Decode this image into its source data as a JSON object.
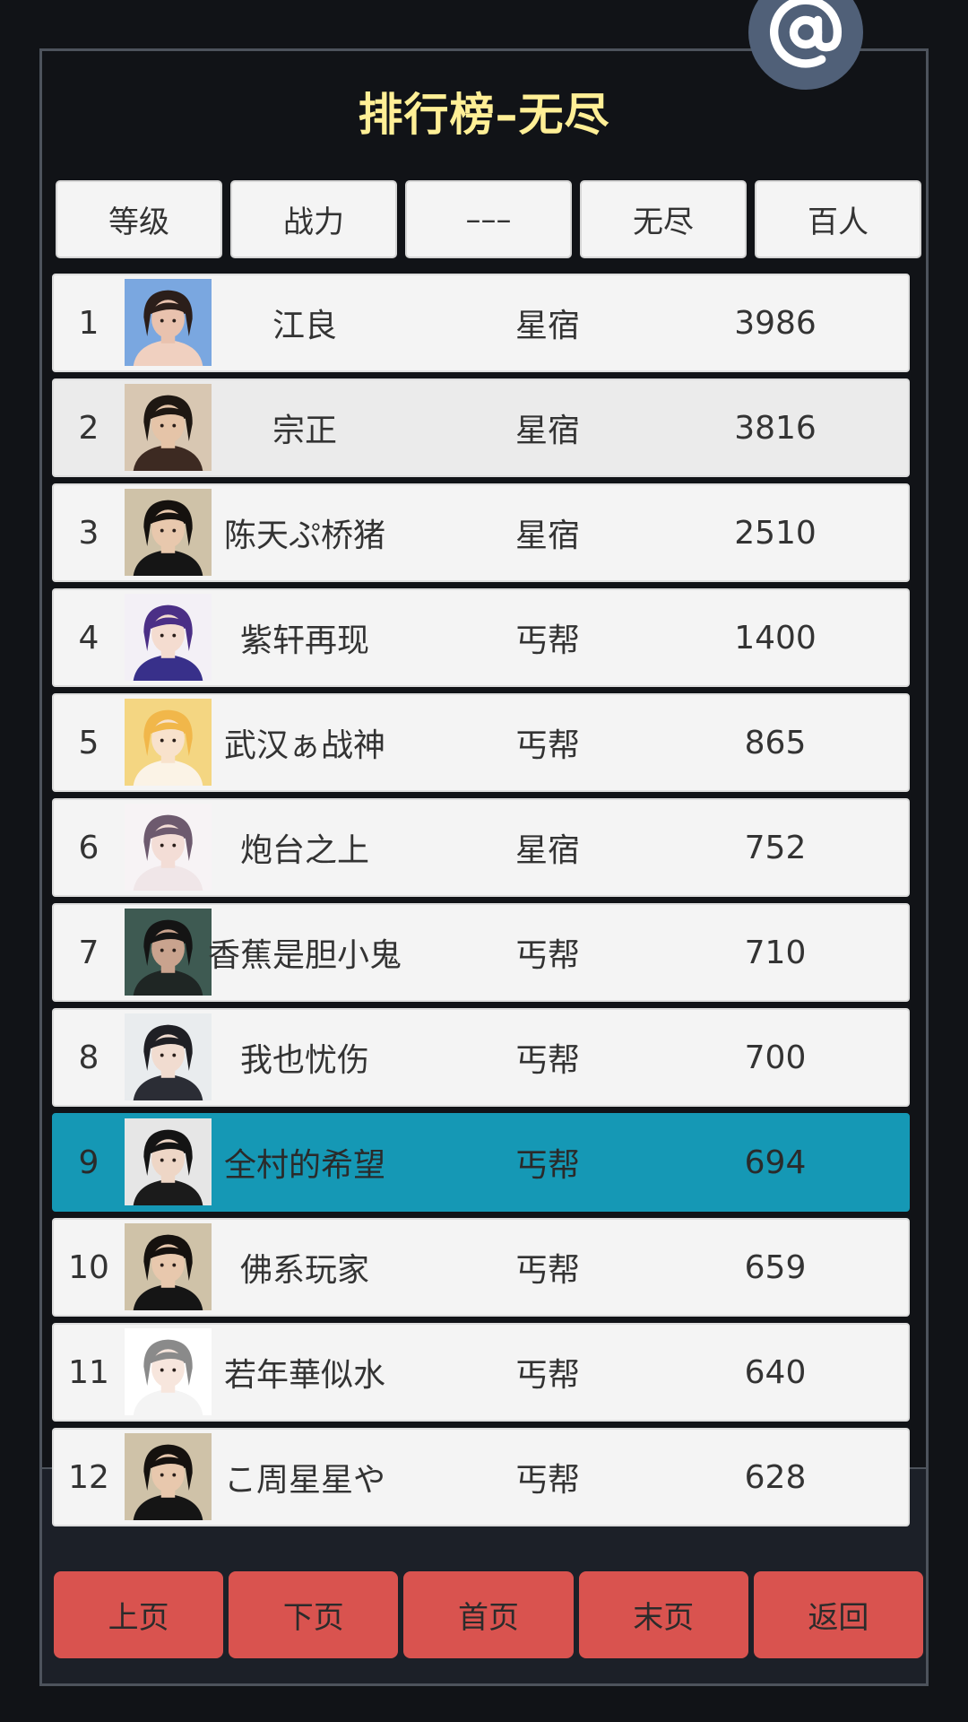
{
  "colors": {
    "background": "#111317",
    "title": "#ffef96",
    "highlight_row": "#1598b5",
    "nav_button": "#d9534f",
    "tab": "#f4f4f4",
    "badge": "#506078"
  },
  "header": {
    "title": "排行榜–无尽",
    "badge_icon": "at-icon"
  },
  "tabs": [
    {
      "label": "等级"
    },
    {
      "label": "战力"
    },
    {
      "label": "–––"
    },
    {
      "label": "无尽"
    },
    {
      "label": "百人"
    }
  ],
  "rows": [
    {
      "rank": "1",
      "name": "江良",
      "guild": "星宿",
      "score": "3986",
      "avatar": "avatar-long-hair-girl"
    },
    {
      "rank": "2",
      "name": "宗正",
      "guild": "星宿",
      "score": "3816",
      "avatar": "avatar-ancient-warrior"
    },
    {
      "rank": "3",
      "name": "陈天ぷ桥猪",
      "guild": "星宿",
      "score": "2510",
      "avatar": "avatar-topknot-man"
    },
    {
      "rank": "4",
      "name": "紫轩再现",
      "guild": "丐帮",
      "score": "1400",
      "avatar": "avatar-purple-hair-boy"
    },
    {
      "rank": "5",
      "name": "武汉ぁ战神",
      "guild": "丐帮",
      "score": "865",
      "avatar": "avatar-blonde-boy"
    },
    {
      "rank": "6",
      "name": "炮台之上",
      "guild": "星宿",
      "score": "752",
      "avatar": "avatar-gray-hair-boy"
    },
    {
      "rank": "7",
      "name": "香蕉是胆小鬼",
      "guild": "丐帮",
      "score": "710",
      "avatar": "avatar-dark-portrait"
    },
    {
      "rank": "8",
      "name": "我也忧伤",
      "guild": "丐帮",
      "score": "700",
      "avatar": "avatar-horned-boy"
    },
    {
      "rank": "9",
      "name": "全村的希望",
      "guild": "丐帮",
      "score": "694",
      "avatar": "avatar-black-hair-man"
    },
    {
      "rank": "10",
      "name": "佛系玩家",
      "guild": "丐帮",
      "score": "659",
      "avatar": "avatar-topknot-man"
    },
    {
      "rank": "11",
      "name": "若年華似水",
      "guild": "丐帮",
      "score": "640",
      "avatar": "avatar-chibi-boy"
    },
    {
      "rank": "12",
      "name": "こ周星星や",
      "guild": "丐帮",
      "score": "628",
      "avatar": "avatar-topknot-man"
    }
  ],
  "highlight_rank": "9",
  "nav": [
    {
      "label": "上页"
    },
    {
      "label": "下页"
    },
    {
      "label": "首页"
    },
    {
      "label": "末页"
    },
    {
      "label": "返回"
    }
  ]
}
